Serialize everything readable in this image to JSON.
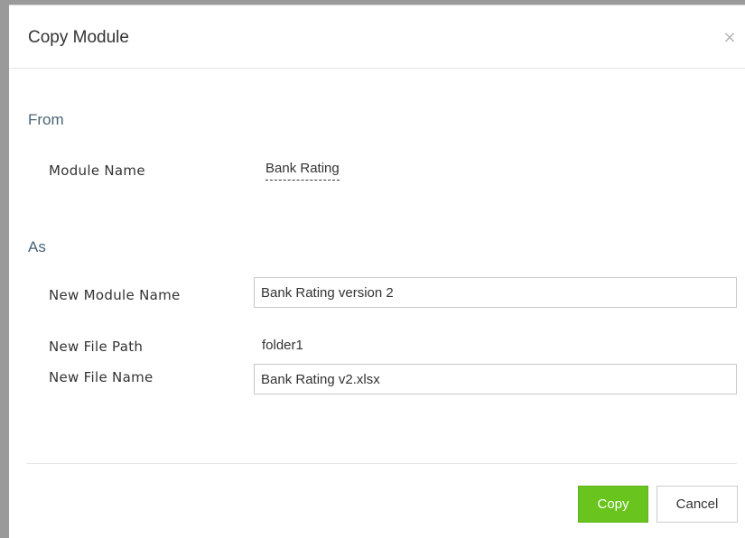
{
  "dialog": {
    "title": "Copy Module",
    "close_icon": "close-icon",
    "close_glyph": "×"
  },
  "from": {
    "section_title": "From",
    "module_name_label": "Module Name",
    "module_name_value": "Bank Rating"
  },
  "as": {
    "section_title": "As",
    "new_module_name_label": "New Module Name",
    "new_module_name_value": "Bank Rating version 2",
    "new_file_path_label": "New File Path",
    "new_file_path_value": "folder1",
    "new_file_name_label": "New File Name",
    "new_file_name_value": "Bank Rating v2.xlsx"
  },
  "footer": {
    "copy_label": "Copy",
    "cancel_label": "Cancel"
  },
  "colors": {
    "copy_button": "#69c51d",
    "section_title": "#4a6476"
  }
}
